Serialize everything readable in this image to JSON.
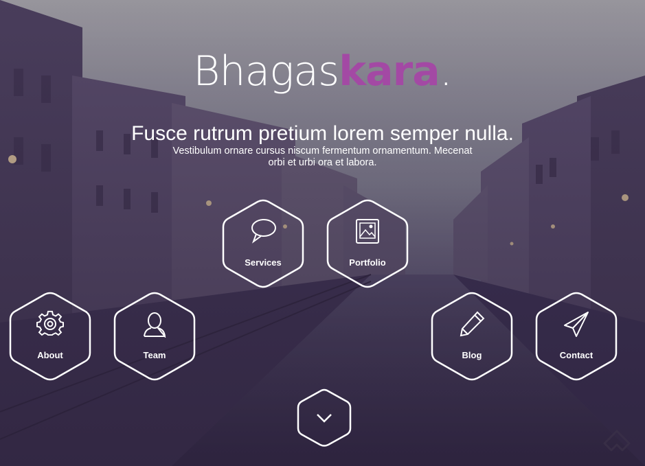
{
  "brand": {
    "prefix": "Bhagas",
    "accent": "kara",
    "dot": "."
  },
  "hero": {
    "headline": "Fusce rutrum pretium lorem semper nulla.",
    "subline_1": "Vestibulum ornare cursus niscum fermentum ornamentum. Mecenat",
    "subline_2": "orbi et urbi ora et labora."
  },
  "nav": {
    "services": {
      "label": "Services",
      "icon": "speech-bubble-icon"
    },
    "portfolio": {
      "label": "Portfolio",
      "icon": "image-icon"
    },
    "about": {
      "label": "About",
      "icon": "gear-icon"
    },
    "team": {
      "label": "Team",
      "icon": "user-icon"
    },
    "blog": {
      "label": "Blog",
      "icon": "pencil-icon"
    },
    "contact": {
      "label": "Contact",
      "icon": "paper-plane-icon"
    }
  },
  "colors": {
    "accent": "#a349a4",
    "overlay": "#4a3a6a"
  }
}
